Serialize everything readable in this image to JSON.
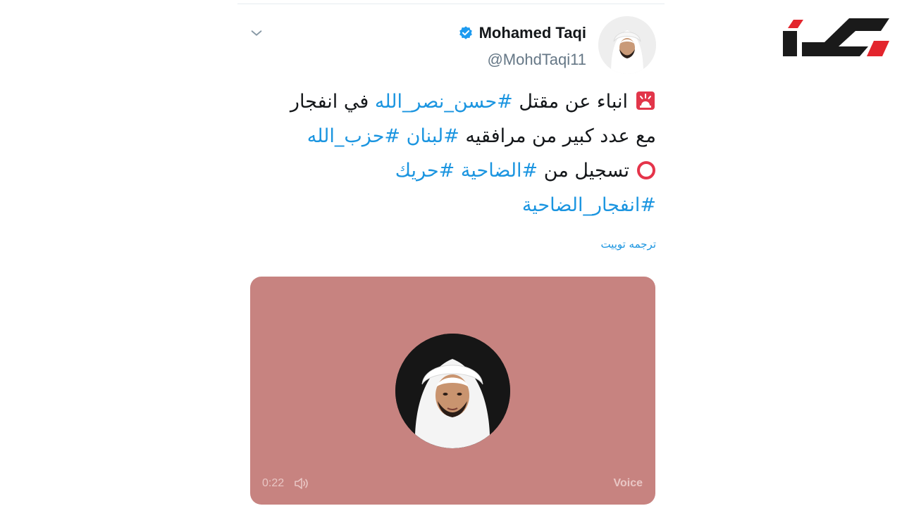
{
  "tweet": {
    "author_name": "Mohamed Taqi",
    "author_handle": "@MohdTaqi11",
    "verified": true,
    "lines": [
      [
        {
          "t": "انباء عن مقتل ",
          "tag": false
        },
        {
          "t": "#حسن_نصر_الله",
          "tag": true
        },
        {
          "t": " في انفجار",
          "tag": false
        }
      ],
      [
        {
          "t": "مع عدد كبير من مرافقيه ",
          "tag": false
        },
        {
          "t": "#لبنان",
          "tag": true
        },
        {
          "t": " ",
          "tag": false
        },
        {
          "t": "#حزب_الله",
          "tag": true
        }
      ],
      [
        {
          "t": "تسجيل من ",
          "tag": false
        },
        {
          "t": "#الضاحية",
          "tag": true
        },
        {
          "t": " ",
          "tag": false
        },
        {
          "t": "#حريك",
          "tag": true
        }
      ],
      [
        {
          "t": "#انفجار_الضاحية",
          "tag": true
        }
      ]
    ],
    "line_icons": [
      "rotating-light-icon",
      "",
      "red-circle-icon",
      ""
    ],
    "translate_label": "ترجمه توییت",
    "media": {
      "duration": "0:22",
      "label": "Voice",
      "background_color": "#c78380"
    }
  },
  "brand": {
    "logo_icon": "site-logo",
    "logo_colors": [
      "#e3252d",
      "#1a1a1a"
    ]
  },
  "colors": {
    "link": "#1b95e0",
    "text": "#14171a",
    "secondary": "#657786"
  }
}
